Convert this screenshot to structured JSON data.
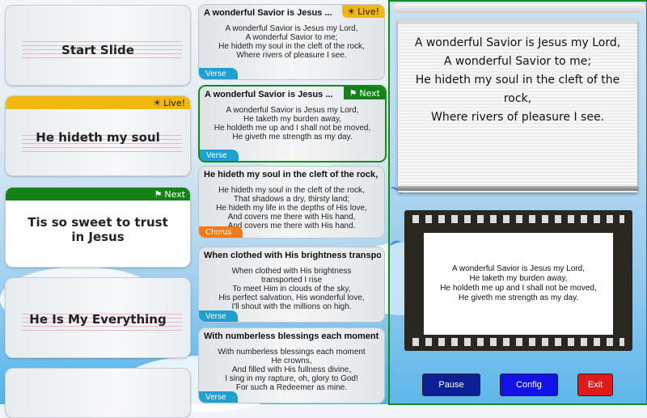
{
  "slides": [
    {
      "title": "Start Slide",
      "badge": ""
    },
    {
      "title": "He hideth my soul",
      "badge": "Live!"
    },
    {
      "title": "Tis so sweet to trust in Jesus",
      "badge": "Next"
    },
    {
      "title": "He Is My Everything",
      "badge": ""
    }
  ],
  "verses": [
    {
      "heading": "A wonderful Savior is Jesus ...",
      "status": "Live!",
      "lines": [
        "A wonderful Savior is Jesus my Lord,",
        "A wonderful Savior to me;",
        "He hideth my soul in the cleft of the rock,",
        "Where rivers of pleasure I see."
      ],
      "tag": "Verse"
    },
    {
      "heading": "A wonderful Savior is Jesus ...",
      "status": "Next",
      "lines": [
        "A wonderful Savior is Jesus my Lord,",
        "He taketh my burden away,",
        "He holdeth me up and I shall not be moved,",
        "He giveth me strength as my day."
      ],
      "tag": "Verse"
    },
    {
      "heading": "He hideth my soul in the cleft of the rock,",
      "status": "",
      "lines": [
        "He hideth my soul in the cleft of the rock,",
        "That shadows a dry, thirsty land;",
        "He hideth my life in the depths of His love,",
        "And covers me there with His hand,",
        "And covers me there with His hand."
      ],
      "tag": "Chorus"
    },
    {
      "heading": "When clothed with His brightness transport...",
      "status": "",
      "lines": [
        "When clothed with His brightness",
        "transported I rise",
        "To meet Him in clouds of the sky,",
        "His perfect salvation, His wonderful love,",
        "I'll shout with the millions on high."
      ],
      "tag": "Verse"
    },
    {
      "heading": "With numberless blessings each moment H...",
      "status": "",
      "lines": [
        "With numberless blessings each moment",
        "He crowns,",
        "And filled with His fullness divine,",
        "I sing in my rapture, oh, glory to God!",
        "For such a Redeemer as mine."
      ],
      "tag": "Verse"
    }
  ],
  "live_screen": {
    "lines": [
      "A wonderful Savior is Jesus my Lord,",
      "A wonderful Savior to me;",
      "He hideth my soul in the cleft of the",
      "rock,",
      "Where rivers of pleasure I see."
    ]
  },
  "preview": {
    "lines": [
      "A wonderful Savior is Jesus my Lord,",
      "He taketh my burden away,",
      "He holdeth me up and I shall not be moved,",
      "He giveth me strength as my day."
    ]
  },
  "buttons": {
    "pause": "Pause",
    "config": "Config",
    "exit": "Exit"
  },
  "colors": {
    "live": "#f3b80e",
    "next": "#158219",
    "pause": "#0c1f96",
    "config": "#1212e8",
    "exit": "#e01a1a"
  },
  "icons": {
    "live": "sun-icon",
    "next": "flag-icon"
  }
}
